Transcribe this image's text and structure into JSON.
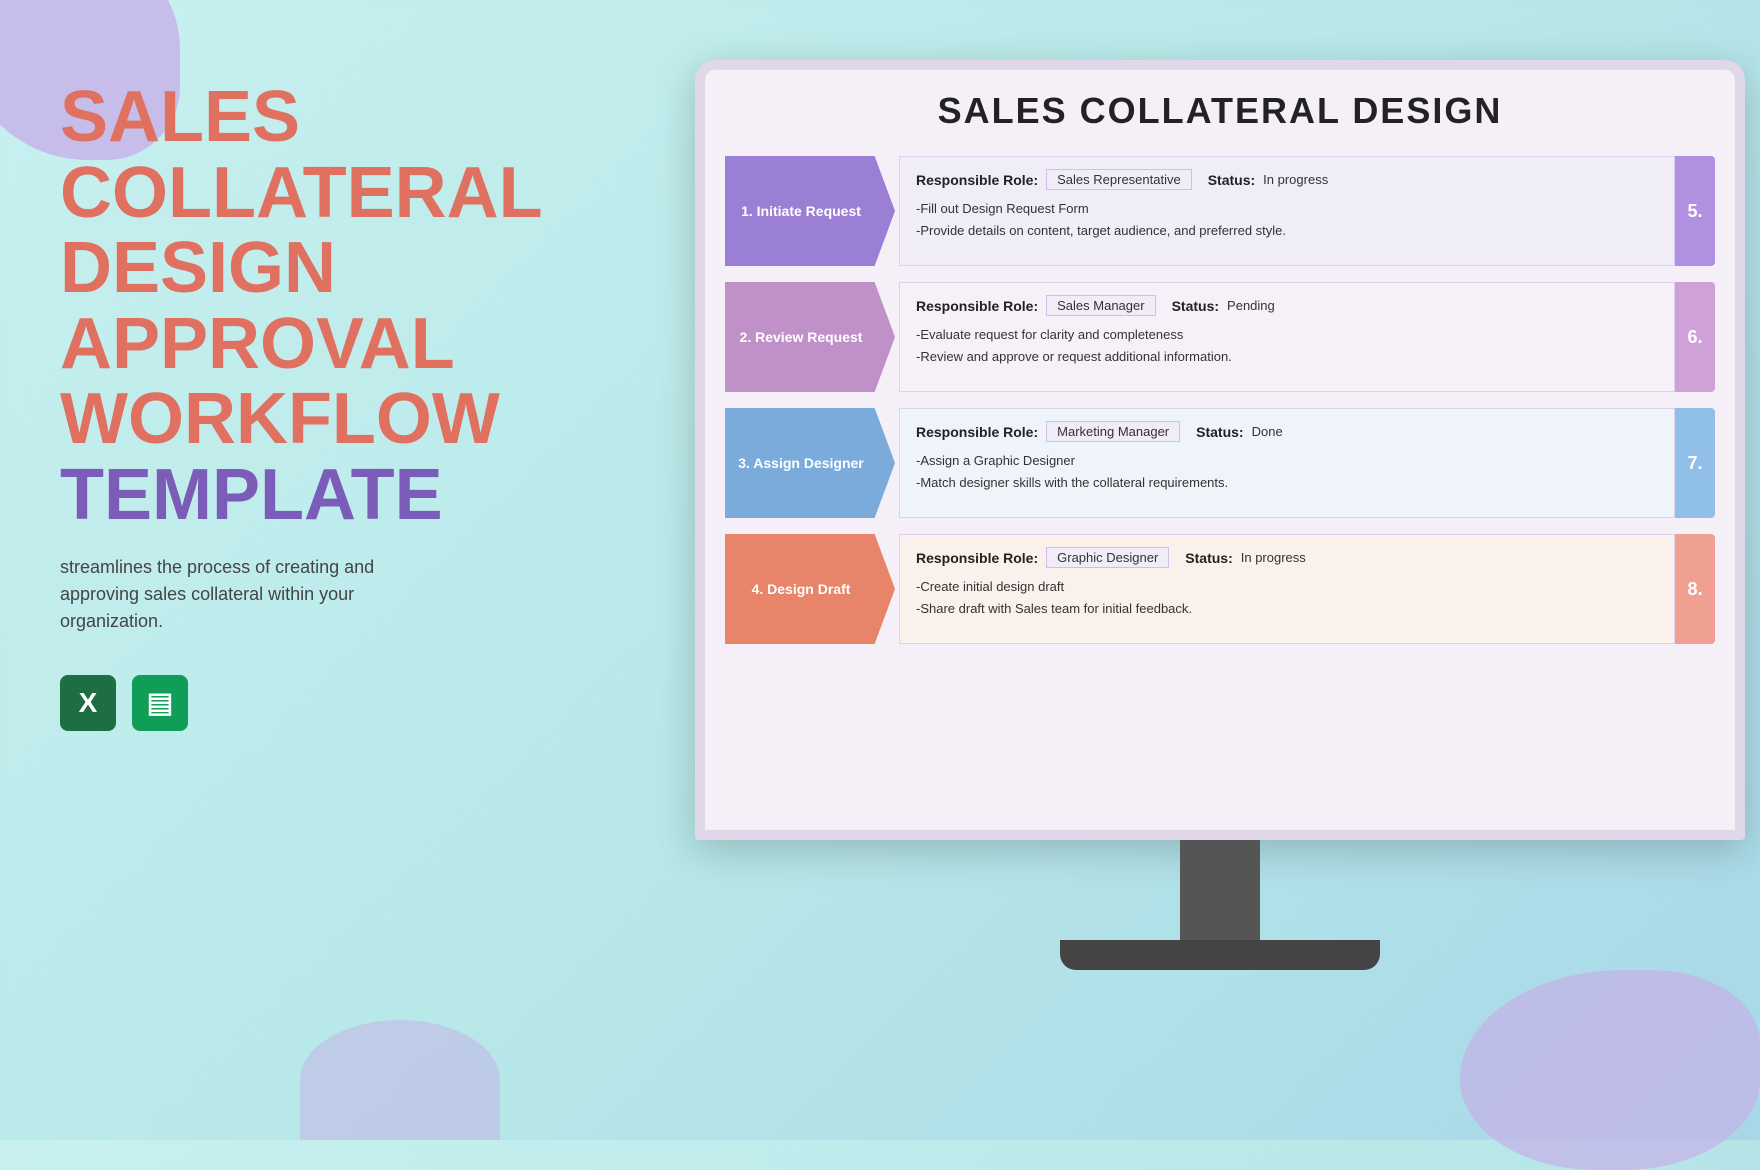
{
  "background": {
    "color": "#b8eae8"
  },
  "left": {
    "title_line1": "SALES",
    "title_line2": "COLLATERAL",
    "title_line3": "DESIGN",
    "title_line4": "APPROVAL",
    "title_line5": "WORKFLOW",
    "title_line6": "TEMPLATE",
    "subtitle": "streamlines the process of creating and approving sales collateral within your organization.",
    "excel_icon": "X",
    "sheets_icon": "▤"
  },
  "screen": {
    "title": "SALES COLLATERAL DESIGN",
    "steps": [
      {
        "id": 1,
        "label": "1. Initiate Request",
        "color": "purple",
        "responsible_role": "Sales Representative",
        "status": "In progress",
        "bullets": [
          "-Fill out Design Request Form",
          "-Provide details on content, target audience, and preferred style."
        ],
        "side_num": "5."
      },
      {
        "id": 2,
        "label": "2. Review Request",
        "color": "mauve",
        "responsible_role": "Sales Manager",
        "status": "Pending",
        "bullets": [
          "-Evaluate request for clarity and completeness",
          "-Review and approve or request additional information."
        ],
        "side_num": "6."
      },
      {
        "id": 3,
        "label": "3. Assign Designer",
        "color": "blue",
        "responsible_role": "Marketing Manager",
        "status": "Done",
        "bullets": [
          "-Assign a Graphic Designer",
          "-Match designer skills with the collateral requirements."
        ],
        "side_num": "7."
      },
      {
        "id": 4,
        "label": "4. Design Draft",
        "color": "coral",
        "responsible_role": "Graphic Designer",
        "status": "In progress",
        "bullets": [
          "-Create initial design draft",
          "-Share draft with Sales team for initial feedback."
        ],
        "side_num": "8."
      }
    ]
  }
}
